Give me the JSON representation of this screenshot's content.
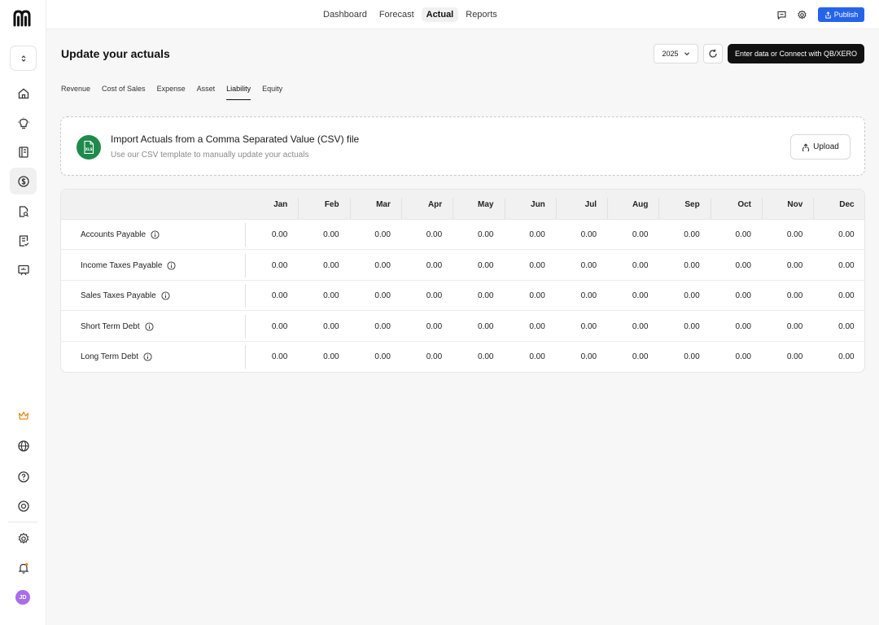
{
  "nav": {
    "tabs": [
      {
        "label": "Dashboard",
        "active": false
      },
      {
        "label": "Forecast",
        "active": false
      },
      {
        "label": "Actual",
        "active": true
      },
      {
        "label": "Reports",
        "active": false
      }
    ],
    "publish_label": "Publish"
  },
  "sidebar": {
    "avatar_initials": "JD",
    "items": [
      "home-icon",
      "lightbulb-icon",
      "book-icon",
      "dollar-icon",
      "file-search-icon",
      "list-check-icon",
      "presentation-icon"
    ],
    "bottom_items": [
      "crown-icon",
      "globe-icon",
      "help-icon",
      "support-icon",
      "settings-icon",
      "bell-icon"
    ],
    "crown_color": "#e8901c"
  },
  "page": {
    "title": "Update your actuals",
    "year": "2025",
    "connect_label": "Enter data or Connect with QB/XERO"
  },
  "subtabs": [
    {
      "label": "Revenue",
      "active": false
    },
    {
      "label": "Cost of Sales",
      "active": false
    },
    {
      "label": "Expense",
      "active": false
    },
    {
      "label": "Asset",
      "active": false
    },
    {
      "label": "Liability",
      "active": true
    },
    {
      "label": "Equity",
      "active": false
    }
  ],
  "import": {
    "title": "Import Actuals from a Comma Separated Value (CSV) file",
    "subtitle": "Use our CSV template to manually update your actuals",
    "icon_text": "XLS",
    "upload_label": "Upload"
  },
  "table": {
    "months": [
      "Jan",
      "Feb",
      "Mar",
      "Apr",
      "May",
      "Jun",
      "Jul",
      "Aug",
      "Sep",
      "Oct",
      "Nov",
      "Dec"
    ],
    "rows": [
      {
        "label": "Accounts Payable",
        "values": [
          "0.00",
          "0.00",
          "0.00",
          "0.00",
          "0.00",
          "0.00",
          "0.00",
          "0.00",
          "0.00",
          "0.00",
          "0.00",
          "0.00"
        ]
      },
      {
        "label": "Income Taxes Payable",
        "values": [
          "0.00",
          "0.00",
          "0.00",
          "0.00",
          "0.00",
          "0.00",
          "0.00",
          "0.00",
          "0.00",
          "0.00",
          "0.00",
          "0.00"
        ]
      },
      {
        "label": "Sales Taxes Payable",
        "values": [
          "0.00",
          "0.00",
          "0.00",
          "0.00",
          "0.00",
          "0.00",
          "0.00",
          "0.00",
          "0.00",
          "0.00",
          "0.00",
          "0.00"
        ]
      },
      {
        "label": "Short Term Debt",
        "values": [
          "0.00",
          "0.00",
          "0.00",
          "0.00",
          "0.00",
          "0.00",
          "0.00",
          "0.00",
          "0.00",
          "0.00",
          "0.00",
          "0.00"
        ]
      },
      {
        "label": "Long Term Debt",
        "values": [
          "0.00",
          "0.00",
          "0.00",
          "0.00",
          "0.00",
          "0.00",
          "0.00",
          "0.00",
          "0.00",
          "0.00",
          "0.00",
          "0.00"
        ]
      }
    ]
  },
  "colors": {
    "accent": "#2563eb",
    "xls_green": "#1f8a4c",
    "dark_button": "#111111",
    "avatar": "#a86ee8"
  }
}
